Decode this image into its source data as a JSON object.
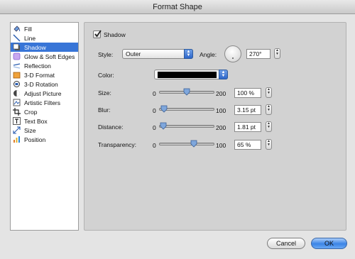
{
  "window": {
    "title": "Format Shape"
  },
  "sidebar": {
    "items": [
      {
        "label": "Fill",
        "icon": "fill-bucket-icon",
        "selected": false
      },
      {
        "label": "Line",
        "icon": "line-icon",
        "selected": false
      },
      {
        "label": "Shadow",
        "icon": "shadow-icon",
        "selected": true
      },
      {
        "label": "Glow & Soft Edges",
        "icon": "glow-icon",
        "selected": false
      },
      {
        "label": "Reflection",
        "icon": "reflection-icon",
        "selected": false
      },
      {
        "label": "3-D Format",
        "icon": "3d-format-icon",
        "selected": false
      },
      {
        "label": "3-D Rotation",
        "icon": "3d-rotation-icon",
        "selected": false
      },
      {
        "label": "Adjust Picture",
        "icon": "adjust-picture-icon",
        "selected": false
      },
      {
        "label": "Artistic Filters",
        "icon": "artistic-filters-icon",
        "selected": false
      },
      {
        "label": "Crop",
        "icon": "crop-icon",
        "selected": false
      },
      {
        "label": "Text Box",
        "icon": "text-box-icon",
        "selected": false
      },
      {
        "label": "Size",
        "icon": "size-icon",
        "selected": false
      },
      {
        "label": "Position",
        "icon": "position-icon",
        "selected": false
      }
    ]
  },
  "shadow": {
    "enabled_label": "Shadow",
    "enabled": true,
    "style_label": "Style:",
    "style_value": "Outer",
    "angle_label": "Angle:",
    "angle_value": "270°",
    "color_label": "Color:",
    "color_value": "#000000",
    "size": {
      "label": "Size:",
      "min": "0",
      "max": "200",
      "value": "100 %",
      "fraction": 0.5
    },
    "blur": {
      "label": "Blur:",
      "min": "0",
      "max": "100",
      "value": "3.15 pt",
      "fraction": 0.03
    },
    "distance": {
      "label": "Distance:",
      "min": "0",
      "max": "200",
      "value": "1.81 pt",
      "fraction": 0.01
    },
    "transparency": {
      "label": "Transparency:",
      "min": "0",
      "max": "100",
      "value": "65 %",
      "fraction": 0.65
    }
  },
  "buttons": {
    "cancel": "Cancel",
    "ok": "OK"
  },
  "colors": {
    "selection": "#3875d7",
    "accent": "#3b84e6"
  }
}
